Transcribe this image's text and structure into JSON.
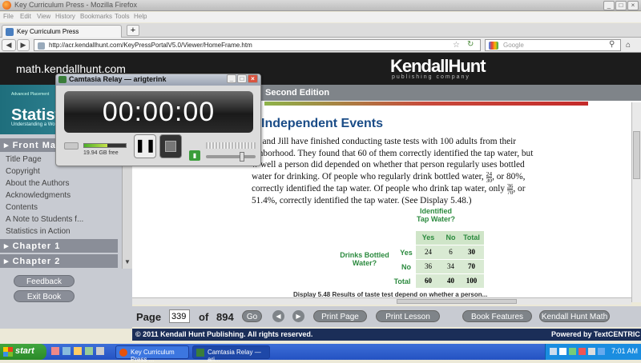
{
  "browser": {
    "title": "Key Curriculum Press - Mozilla Firefox",
    "menus": [
      "File",
      "Edit",
      "View",
      "History",
      "Bookmarks",
      "Tools",
      "Help"
    ],
    "tab_label": "Key Curriculum Press",
    "new_tab": "+",
    "url": "http://acr.kendallhunt.com/KeyPressPortalV5.0/Viewer/HomeFrame.htm",
    "search_placeholder": "Google"
  },
  "site": {
    "url_text": "math.kendallhunt.com",
    "logo": "KendallHunt",
    "logo_sub": "publishing company",
    "edition": "Second Edition"
  },
  "book": {
    "cover_title": "Statistic",
    "cover_small": "Advanced Placement",
    "cover_sub": "Understanding a World of"
  },
  "sidebar": {
    "front_matter": "Front Ma",
    "toc_items": [
      "Title Page",
      "Copyright",
      "About the Authors",
      "Acknowledgments",
      "Contents",
      "A Note to Students f...",
      "Statistics in Action"
    ],
    "chapter1": "Chapter 1",
    "chapter2": "Chapter 2",
    "feedback": "Feedback",
    "exit": "Exit Book"
  },
  "content": {
    "heading": "Independent Events",
    "line1": "ck and Jill have finished conducting taste tests with 100 adults from their",
    "line2": "ighborhood. They found that 60 of them correctly identified the tap water, but",
    "line3": "w well a person did depended on whether that person regularly uses bottled",
    "line4": "water for drinking. Of people who regularly drink bottled water,",
    "frac1_num": "24",
    "frac1_den": "30",
    "line4b": ", or 80%,",
    "line5": "correctly identified the tap water. Of people who drink tap water, only",
    "frac2_num": "36",
    "frac2_den": "70",
    "line5b": ", or",
    "line6": "51.4%, correctly identified the tap water. (See Display 5.48.)",
    "caption": "Display 5.48   Results of taste test depend on whether a person..."
  },
  "table": {
    "col_group": "Identified Tap Water?",
    "row_group": "Drinks Bottled Water?",
    "cols": [
      "Yes",
      "No",
      "Total"
    ],
    "rows": [
      {
        "label": "Yes",
        "vals": [
          "24",
          "6",
          "30"
        ]
      },
      {
        "label": "No",
        "vals": [
          "36",
          "34",
          "70"
        ]
      },
      {
        "label": "Total",
        "vals": [
          "60",
          "40",
          "100"
        ]
      }
    ]
  },
  "pager": {
    "page_label": "Page",
    "page_value": "339",
    "of_label": "of",
    "total": "894",
    "go": "Go",
    "print_page": "Print Page",
    "print_lesson": "Print Lesson",
    "book_features": "Book Features",
    "kh_math": "Kendall Hunt Math"
  },
  "footer": {
    "copyright": "© 2011 Kendall Hunt Publishing. All rights reserved.",
    "powered": "Powered by TextCENTRIC"
  },
  "camtasia": {
    "title": "Camtasia Relay — arigterink",
    "timer": "00:00:00",
    "disk_free": "19.94 GB free",
    "meter_level": 0.55
  },
  "taskbar": {
    "start": "start",
    "task1": "Key Curriculum Press ...",
    "task2": "Camtasia Relay — ari...",
    "clock": "7:01 AM"
  },
  "colors": {
    "heading_blue": "#1a4c87",
    "table_green": "#2b8a3e",
    "footer_navy": "#1b2e58"
  }
}
